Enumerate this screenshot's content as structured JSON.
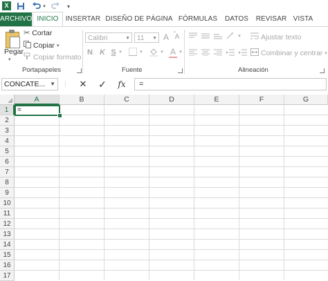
{
  "quick_access": {
    "app_icon": "excel-icon",
    "app_letter": "X",
    "save_icon": "save-icon",
    "undo_icon": "undo-icon",
    "redo_icon": "redo-icon",
    "customize_icon": "customize-dropdown-icon"
  },
  "tabs": [
    {
      "label": "ARCHIVO"
    },
    {
      "label": "INICIO"
    },
    {
      "label": "INSERTAR"
    },
    {
      "label": "DISEÑO DE PÁGINA"
    },
    {
      "label": "FÓRMULAS"
    },
    {
      "label": "DATOS"
    },
    {
      "label": "REVISAR"
    },
    {
      "label": "VISTA"
    }
  ],
  "clipboard": {
    "paste_label": "Pegar",
    "cut_label": "Cortar",
    "copy_label": "Copiar",
    "format_painter_label": "Copiar formato",
    "group_label": "Portapapeles"
  },
  "font": {
    "font_name": "Calibri",
    "font_size": "11",
    "grow_label": "A",
    "shrink_label": "A",
    "bold_label": "N",
    "italic_label": "K",
    "underline_label": "S",
    "font_color_label": "A",
    "group_label": "Fuente"
  },
  "alignment": {
    "wrap_text_label": "Ajustar texto",
    "merge_center_label": "Combinar y centrar",
    "group_label": "Alineación"
  },
  "formula_bar": {
    "name_box": "CONCATE...",
    "cancel_symbol": "✕",
    "enter_symbol": "✓",
    "fx_symbol": "fx",
    "formula": "="
  },
  "grid": {
    "columns": [
      "A",
      "B",
      "C",
      "D",
      "E",
      "F",
      "G"
    ],
    "rows": [
      "1",
      "2",
      "3",
      "4",
      "5",
      "6",
      "7",
      "8",
      "9",
      "10",
      "11",
      "12",
      "13",
      "14",
      "15",
      "16",
      "17"
    ],
    "active_cell_value": "="
  },
  "colors": {
    "accent": "#217346",
    "disabled_text": "#a8a8a8"
  }
}
